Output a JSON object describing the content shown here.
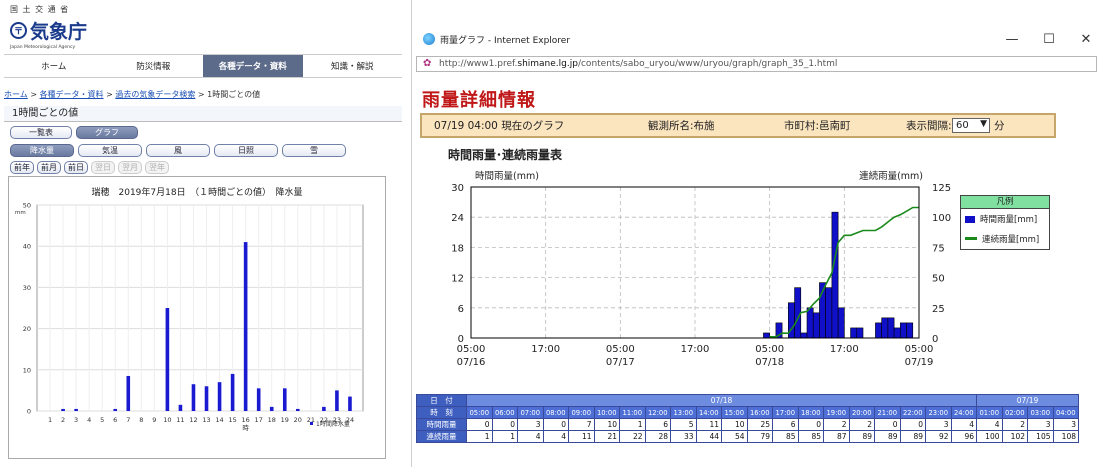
{
  "jma": {
    "ministry": "国 土 交 通 省",
    "name": "気象庁",
    "english": "Japan Meteorological Agency",
    "nav": [
      "ホーム",
      "防災情報",
      "各種データ・資料",
      "知識・解説"
    ],
    "nav_active": 2,
    "breadcrumb": {
      "home": "ホーム",
      "data": "各種データ・資料",
      "past": "過去の気象データ検索",
      "current": "1時間ごとの値"
    },
    "section_title": "1時間ごとの値",
    "view_buttons": [
      "一覧表",
      "グラフ"
    ],
    "element_buttons": [
      "降水量",
      "気温",
      "風",
      "日照",
      "雪"
    ],
    "period_buttons": [
      "前年",
      "前月",
      "前日",
      "翌日",
      "翌月",
      "翌年"
    ],
    "chart_title": "瑞穂　2019年7月18日　（１時間ごとの値）　降水量",
    "y_unit": "mm",
    "x_unit": "時",
    "legend": "1時間降水量"
  },
  "ie": {
    "title": "雨量グラフ - Internet Explorer",
    "url_prefix": "http://www1.pref.",
    "url_domain": "shimane.lg.jp",
    "url_rest": "/contents/sabo_uryou/www/uryou/graph/graph_35_1.html",
    "controls": [
      "—",
      "☐",
      "✕"
    ]
  },
  "rain": {
    "header": "雨量詳細情報",
    "current": "07/19 04:00 現在のグラフ",
    "station": "観測所名:布施",
    "municipality": "市町村:邑南町",
    "interval_label": "表示間隔:",
    "interval_value": "60",
    "interval_unit": "分",
    "chart_heading": "時間雨量･連続雨量表",
    "legend_title": "凡例",
    "legend_bar": "時間雨量[mm]",
    "legend_line": "連続雨量[mm]",
    "table": {
      "label_date": "日　付",
      "label_time": "時　刻",
      "label_hourly": "時間雨量",
      "label_cumulative": "連続雨量",
      "date_groups": [
        {
          "label": "07/18",
          "span": 20
        },
        {
          "label": "07/19",
          "span": 4
        }
      ],
      "times": [
        "05:00",
        "06:00",
        "07:00",
        "08:00",
        "09:00",
        "10:00",
        "11:00",
        "12:00",
        "13:00",
        "14:00",
        "15:00",
        "16:00",
        "17:00",
        "18:00",
        "19:00",
        "20:00",
        "21:00",
        "22:00",
        "23:00",
        "24:00",
        "01:00",
        "02:00",
        "03:00",
        "04:00"
      ],
      "hourly": [
        "0",
        "0",
        "3",
        "0",
        "7",
        "10",
        "1",
        "6",
        "5",
        "11",
        "10",
        "25",
        "6",
        "0",
        "2",
        "2",
        "0",
        "0",
        "3",
        "4",
        "4",
        "2",
        "3",
        "3"
      ],
      "cumulative": [
        "1",
        "1",
        "4",
        "4",
        "11",
        "21",
        "22",
        "28",
        "33",
        "44",
        "54",
        "79",
        "85",
        "85",
        "87",
        "89",
        "89",
        "89",
        "92",
        "96",
        "100",
        "102",
        "105",
        "108"
      ]
    }
  },
  "chart_data": [
    {
      "type": "bar",
      "title": "瑞穂　2019年7月18日　（１時間ごとの値）　降水量",
      "xlabel": "時",
      "ylabel": "mm",
      "categories": [
        "1",
        "2",
        "3",
        "4",
        "5",
        "6",
        "7",
        "8",
        "9",
        "10",
        "11",
        "12",
        "13",
        "14",
        "15",
        "16",
        "17",
        "18",
        "19",
        "20",
        "21",
        "22",
        "23",
        "24"
      ],
      "series": [
        {
          "name": "1時間降水量",
          "values": [
            0,
            0.5,
            0.5,
            0,
            0,
            0.5,
            8.5,
            0,
            0,
            25,
            1.5,
            6.5,
            6,
            7,
            9,
            41,
            5.5,
            1,
            5.5,
            0.5,
            0,
            1,
            5,
            3.5
          ],
          "color": "#1a1ad0"
        }
      ],
      "ylim": [
        0,
        50
      ],
      "yticks": [
        0,
        10,
        20,
        30,
        40,
        50
      ],
      "grid": true,
      "legend": "bottom-right"
    },
    {
      "type": "bar",
      "title": "時間雨量･連続雨量表",
      "x_ticks": [
        {
          "time": "05:00",
          "date": "07/16"
        },
        {
          "time": "17:00",
          "date": ""
        },
        {
          "time": "05:00",
          "date": "07/17"
        },
        {
          "time": "17:00",
          "date": ""
        },
        {
          "time": "05:00",
          "date": "07/18"
        },
        {
          "time": "17:00",
          "date": ""
        },
        {
          "time": "05:00",
          "date": "07/19"
        }
      ],
      "ylabel_left": "時間雨量(mm)",
      "ylabel_right": "連続雨量(mm)",
      "ylim_left": [
        0,
        30
      ],
      "ylim_right": [
        0,
        125
      ],
      "yticks_left": [
        0,
        6,
        12,
        18,
        24,
        30
      ],
      "yticks_right": [
        0,
        25,
        50,
        75,
        100,
        125
      ],
      "hours_from_start": [
        48,
        49,
        50,
        51,
        52,
        53,
        54,
        55,
        56,
        57,
        58,
        59,
        60,
        61,
        62,
        63,
        64,
        65,
        66,
        67,
        68,
        69,
        70,
        71,
        72
      ],
      "series": [
        {
          "name": "時間雨量[mm]",
          "type": "bar",
          "axis": "left",
          "color": "#1010c8",
          "values": [
            1,
            0,
            3,
            0,
            7,
            10,
            1,
            6,
            5,
            11,
            10,
            25,
            6,
            0,
            2,
            2,
            0,
            0,
            3,
            4,
            4,
            2,
            3,
            3,
            0
          ]
        },
        {
          "name": "連続雨量[mm]",
          "type": "line",
          "axis": "right",
          "color": "#1a8a1a",
          "values": [
            1,
            1,
            4,
            4,
            11,
            21,
            22,
            28,
            33,
            44,
            54,
            79,
            85,
            85,
            87,
            89,
            89,
            89,
            92,
            96,
            100,
            102,
            105,
            108,
            108
          ]
        }
      ],
      "grid": true,
      "legend": "right"
    }
  ]
}
